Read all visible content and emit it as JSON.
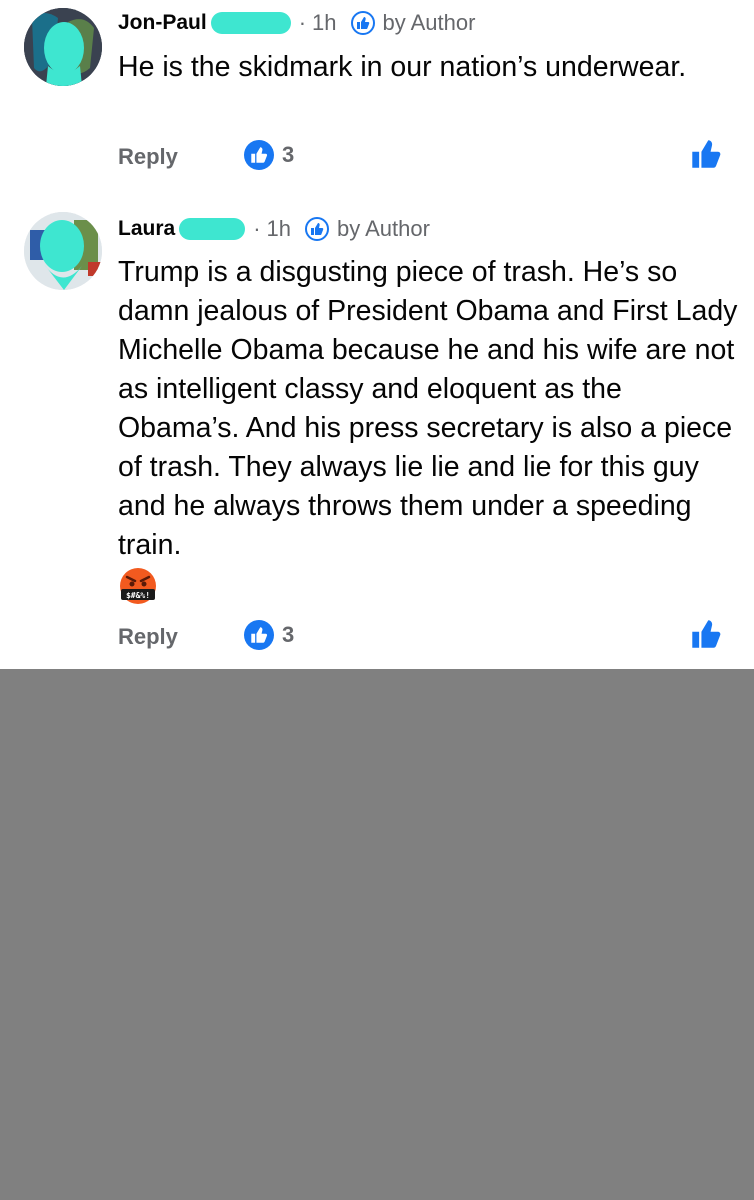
{
  "comments": [
    {
      "author": "Jon-Paul",
      "time": "1h",
      "badge": "by Author",
      "text": "He is the skidmark in our nation’s underwear.",
      "reply_label": "Reply",
      "reaction_count": "3"
    },
    {
      "author": "Laura",
      "time": "1h",
      "badge": "by Author",
      "text": "Trump is a disgusting piece of trash. He’s so damn jealous of President Obama and First Lady Michelle Obama because he and his wife are not as intelligent classy and eloquent as the Obama’s. And his press secretary is also a piece of trash. They always lie lie and lie for this guy and he always throws them under a speeding train.",
      "emoji": "$#&%!",
      "reply_label": "Reply",
      "reaction_count": "3"
    }
  ],
  "colors": {
    "accent": "#1877f2",
    "meta": "#65676b",
    "redaction": "#3ee6d0",
    "blank_area": "#808080"
  },
  "icons": [
    "thumbs-up-icon",
    "like-reaction-icon",
    "angry-emoji-icon"
  ]
}
